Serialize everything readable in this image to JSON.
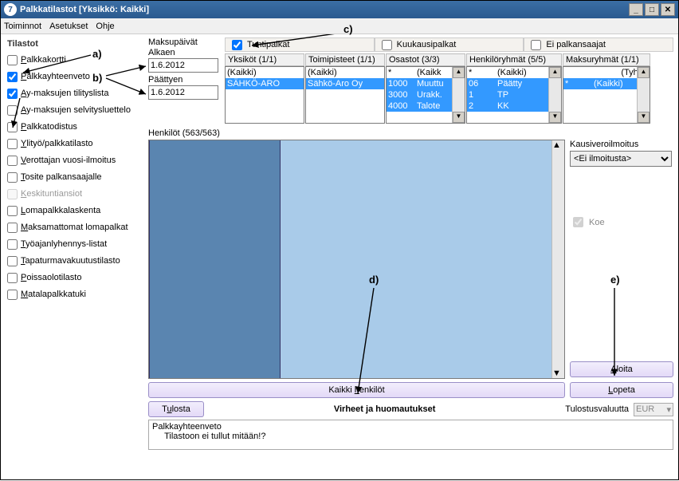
{
  "window": {
    "title": "Palkkatilastot [Yksikkö: Kaikki]"
  },
  "menu": {
    "toiminnot": "Toiminnot",
    "asetukset": "Asetukset",
    "ohje": "Ohje"
  },
  "left": {
    "heading": "Tilastot",
    "items": [
      {
        "label": "Palkkakortti",
        "checked": false
      },
      {
        "label": "Palkkayhteenveto",
        "checked": true
      },
      {
        "label": "Ay-maksujen tilityslista",
        "checked": true
      },
      {
        "label": "Ay-maksujen selvitysluettelo",
        "checked": false
      },
      {
        "label": "Palkkatodistus",
        "checked": false
      },
      {
        "label": "Ylityö/palkkatilasto",
        "checked": false
      },
      {
        "label": "Verottajan vuosi-ilmoitus",
        "checked": false
      },
      {
        "label": "Tosite palkansaajalle",
        "checked": false
      },
      {
        "label": "Keskituntiansiot",
        "checked": false,
        "disabled": true
      },
      {
        "label": "Lomapalkkalaskenta",
        "checked": false
      },
      {
        "label": "Maksamattomat lomapalkat",
        "checked": false
      },
      {
        "label": "Työajanlyhennys-listat",
        "checked": false
      },
      {
        "label": "Tapaturmavakuutustilasto",
        "checked": false
      },
      {
        "label": "Poissaolotilasto",
        "checked": false
      },
      {
        "label": "Matalapalkkatuki",
        "checked": false
      }
    ]
  },
  "dates": {
    "header": "Maksupäivät",
    "alkaen_lbl": "Alkaen",
    "alkaen_val": "1.6.2012",
    "paattyen_lbl": "Päättyen",
    "paattyen_val": "1.6.2012"
  },
  "filterchecks": {
    "tunti": "Tuntipalkat",
    "kk": "Kuukausipalkat",
    "eipalk": "Ei palkansaajat"
  },
  "filters": {
    "yksikot": {
      "hdr": "Yksiköt (1/1)",
      "rows": [
        "(Kaikki)",
        "SÄHKÖ-ARO"
      ]
    },
    "toimipisteet": {
      "hdr": "Toimipisteet (1/1)",
      "rows": [
        "(Kaikki)",
        "Sähkö-Aro Oy"
      ]
    },
    "osastot": {
      "hdr": "Osastot (3/3)",
      "rows": [
        {
          "a": "*",
          "b": "(Kaikk"
        },
        {
          "a": "1000",
          "b": "Muuttu"
        },
        {
          "a": "3000",
          "b": "Urakk."
        },
        {
          "a": "4000",
          "b": "Talote"
        }
      ]
    },
    "henkiloryhmat": {
      "hdr": "Henkilöryhmät (5/5)",
      "rows": [
        {
          "a": "*",
          "b": "(Kaikki)"
        },
        {
          "a": "06",
          "b": "Päätty"
        },
        {
          "a": "1",
          "b": "TP"
        },
        {
          "a": "2",
          "b": "KK"
        }
      ]
    },
    "maksuryhmat": {
      "hdr": "Maksuryhmät (1/1)",
      "rows": [
        {
          "a": "",
          "b": "(Tyhjä)"
        },
        {
          "a": "*",
          "b": "(Kaikki)"
        }
      ]
    }
  },
  "henkilot": {
    "title": "Henkilöt (563/563)"
  },
  "kausi": {
    "label": "Kausiveroilmoitus",
    "value": "<Ei ilmoitusta>"
  },
  "koe": "Koe",
  "buttons": {
    "kaikki": "Kaikki henkilöt",
    "aloita": "Aloita",
    "lopeta": "Lopeta",
    "tulosta": "Tulosta"
  },
  "bottom": {
    "heading": "Virheet ja huomautukset",
    "tulostusvaluutta": "Tulostusvaluutta",
    "eurbox": "EUR",
    "msg1": "Palkkayhteenveto",
    "msg2": "     Tilastoon ei tullut mitään!?"
  },
  "annot": {
    "a": "a)",
    "b": "b)",
    "c": "c)",
    "d": "d)",
    "e": "e)"
  }
}
